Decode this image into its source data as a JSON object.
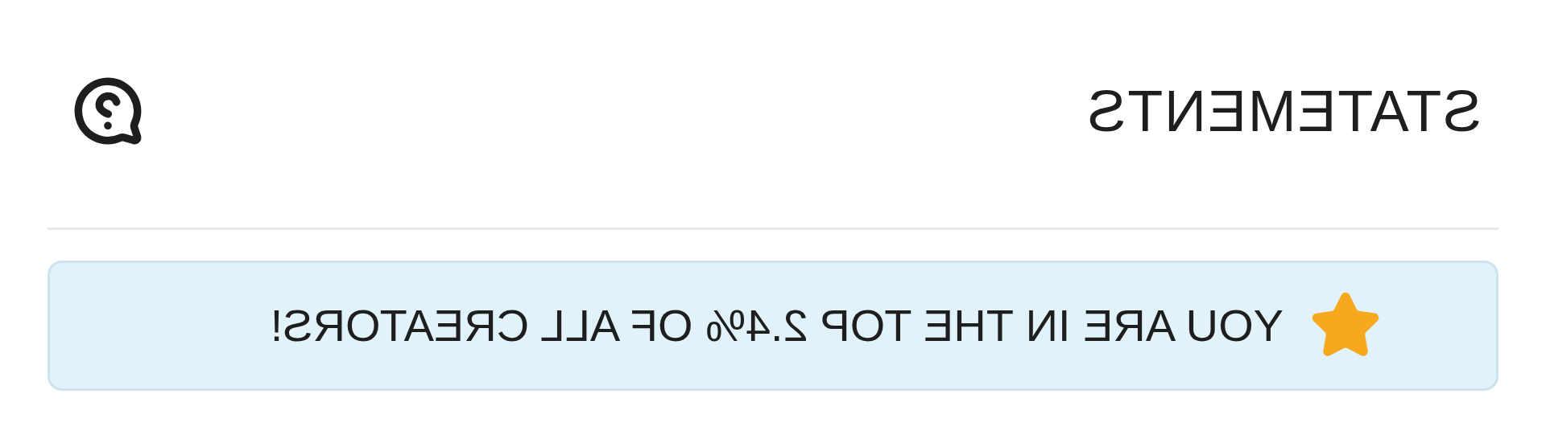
{
  "header": {
    "title": "STATEMENTS"
  },
  "banner": {
    "text": "YOU ARE IN THE TOP 2.4% OF ALL CREATORS!"
  }
}
